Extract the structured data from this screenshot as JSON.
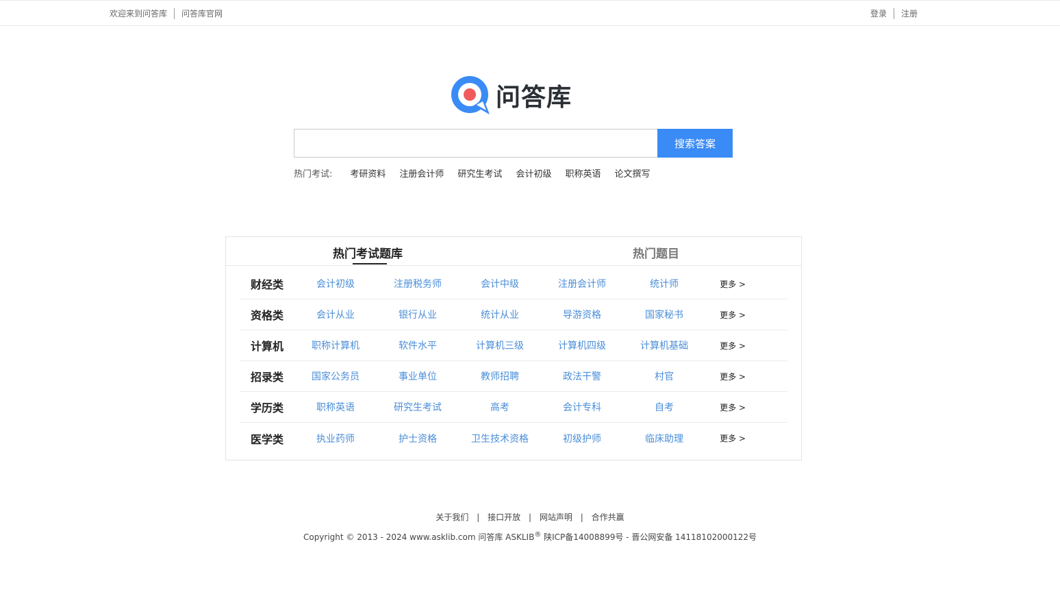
{
  "topbar": {
    "welcome": "欢迎来到问答库",
    "official_site": "问答库官网",
    "login": "登录",
    "register": "注册"
  },
  "logo": {
    "text": "问答库",
    "icon": "chat-bubble-q-icon",
    "brand_color": "#3a8bf5",
    "accent_color": "#f05a5a"
  },
  "search": {
    "placeholder": "",
    "button_label": "搜索答案"
  },
  "hot_exams": {
    "label": "热门考试:",
    "links": [
      "考研资料",
      "注册会计师",
      "研究生考试",
      "会计初级",
      "职称英语",
      "论文撰写"
    ]
  },
  "panel": {
    "tabs": [
      "热门考试题库",
      "热门题目"
    ],
    "more_label": "更多 >",
    "rows": [
      {
        "category": "财经类",
        "items": [
          "会计初级",
          "注册税务师",
          "会计中级",
          "注册会计师",
          "统计师"
        ]
      },
      {
        "category": "资格类",
        "items": [
          "会计从业",
          "银行从业",
          "统计从业",
          "导游资格",
          "国家秘书"
        ]
      },
      {
        "category": "计算机",
        "items": [
          "职称计算机",
          "软件水平",
          "计算机三级",
          "计算机四级",
          "计算机基础"
        ]
      },
      {
        "category": "招录类",
        "items": [
          "国家公务员",
          "事业单位",
          "教师招聘",
          "政法干警",
          "村官"
        ]
      },
      {
        "category": "学历类",
        "items": [
          "职称英语",
          "研究生考试",
          "高考",
          "会计专科",
          "自考"
        ]
      },
      {
        "category": "医学类",
        "items": [
          "执业药师",
          "护士资格",
          "卫生技术资格",
          "初级护师",
          "临床助理"
        ]
      }
    ]
  },
  "footer": {
    "links": [
      "关于我们",
      "接口开放",
      "网站声明",
      "合作共赢"
    ],
    "separator": "|",
    "copyright_prefix": "Copyright © 2013 - 2024 www.asklib.com  问答库  ASKLIB",
    "registered_mark": "®",
    "copyright_suffix": " 陕ICP备14008899号 - 晋公网安备 14118102000122号"
  }
}
